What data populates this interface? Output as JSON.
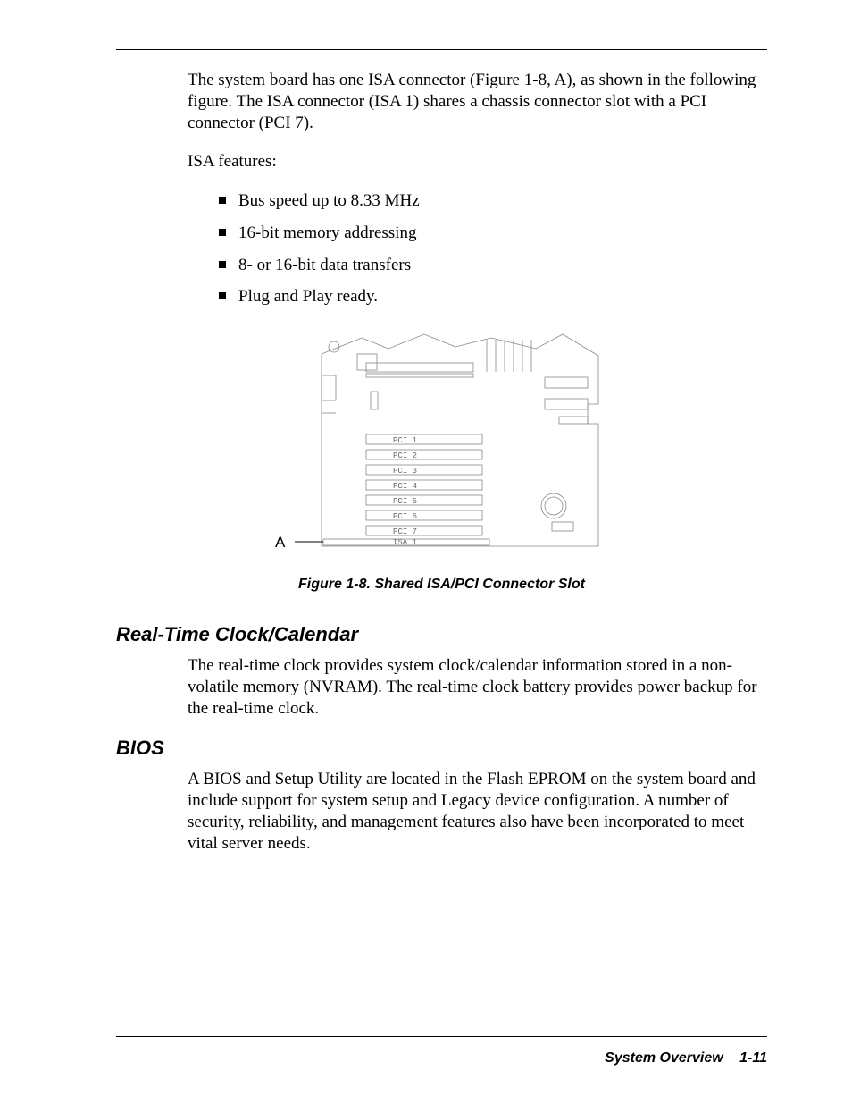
{
  "intro_para": "The system board has one ISA connector (Figure 1-8, A), as shown in the following figure. The ISA connector (ISA 1) shares a chassis connector slot with a PCI connector (PCI 7).",
  "isa_features_label": "ISA features:",
  "bullets": [
    "Bus speed up to 8.33 MHz",
    "16-bit memory addressing",
    "8- or 16-bit data transfers",
    "Plug and Play ready."
  ],
  "figure": {
    "marker": "A",
    "slots": [
      "PCI  1",
      "PCI  2",
      "PCI  3",
      "PCI  4",
      "PCI  5",
      "PCI  6",
      "PCI  7",
      "ISA  1"
    ],
    "caption": "Figure 1-8. Shared ISA/PCI Connector Slot"
  },
  "sections": {
    "rtc_heading": "Real-Time Clock/Calendar",
    "rtc_para": "The real-time clock provides system clock/calendar information stored in a non-volatile memory (NVRAM). The real-time clock battery provides power backup for the real-time clock.",
    "bios_heading": "BIOS",
    "bios_para": "A BIOS and Setup Utility are located in the Flash EPROM on the system board and include support for system setup and Legacy device configuration. A number of security, reliability, and management features also have been incorporated to meet vital server needs."
  },
  "footer": {
    "title": "System Overview",
    "page": "1-11"
  }
}
